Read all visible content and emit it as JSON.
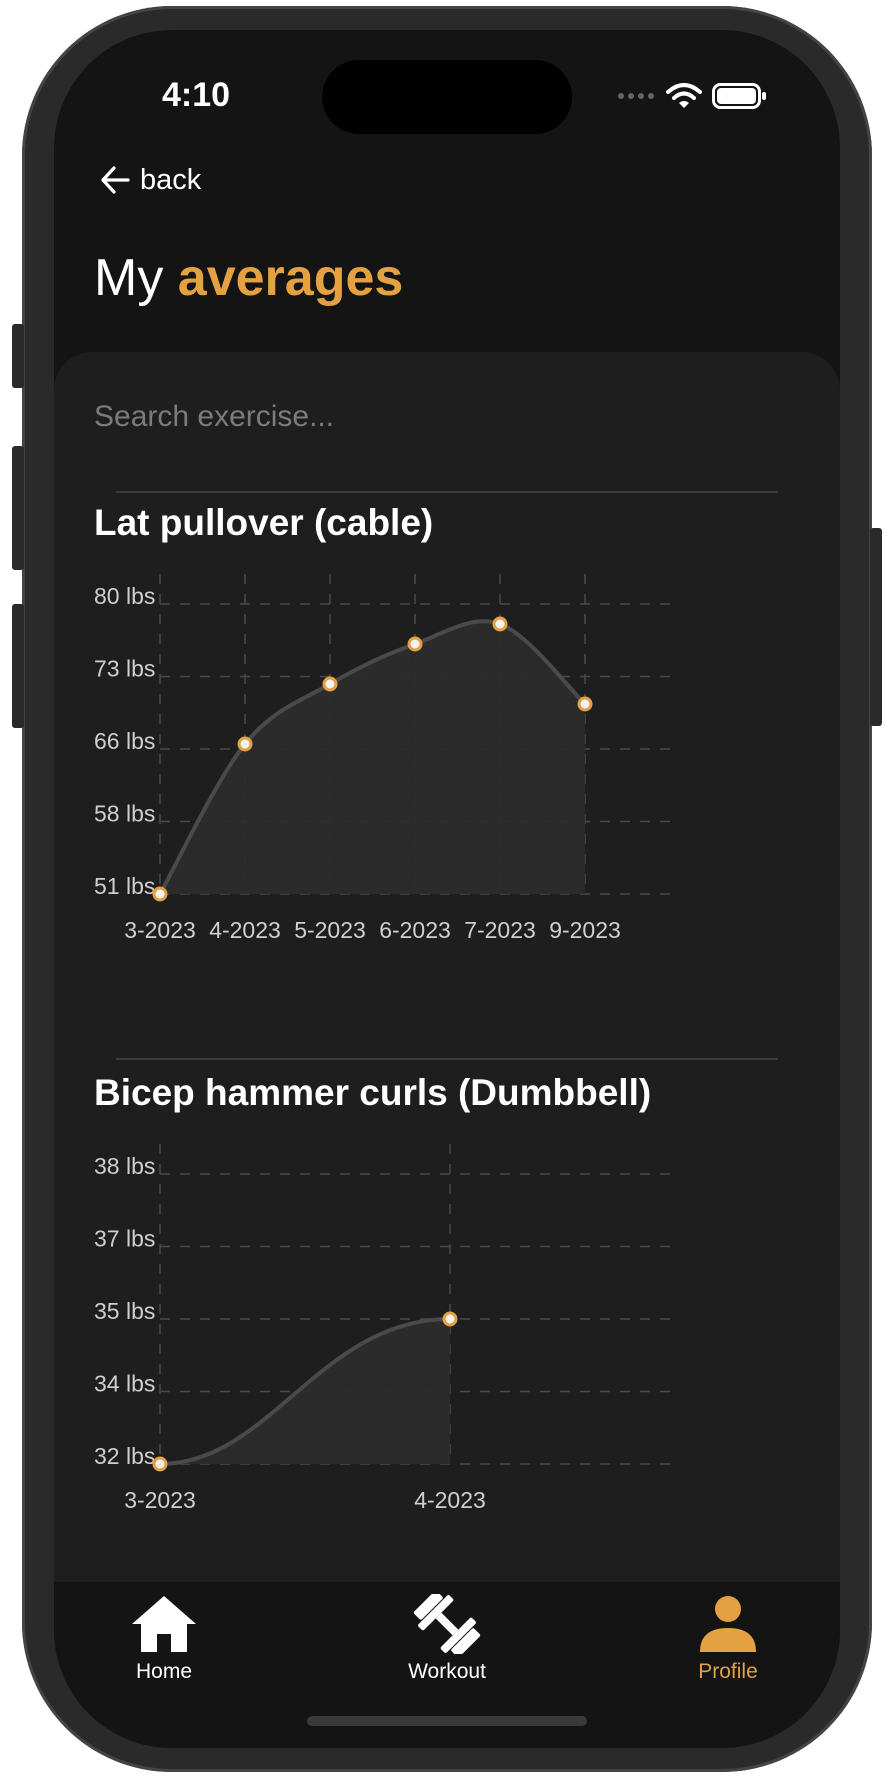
{
  "status": {
    "time": "4:10"
  },
  "nav": {
    "back_label": "back"
  },
  "page": {
    "title_plain": "My",
    "title_accent": "averages"
  },
  "search": {
    "placeholder": "Search exercise..."
  },
  "colors": {
    "accent": "#E3A141",
    "background": "#141414",
    "card": "#1e1e1e",
    "line": "#4a4a4a",
    "area": "#2c2c2c"
  },
  "charts": [
    {
      "title": "Lat pullover (cable)",
      "chart_data": {
        "type": "area",
        "title": "Lat pullover (cable)",
        "categories": [
          "3-2023",
          "4-2023",
          "5-2023",
          "6-2023",
          "7-2023",
          "9-2023"
        ],
        "values": [
          51,
          66,
          72,
          76,
          78,
          70
        ],
        "y_ticks": [
          "80 lbs",
          "73 lbs",
          "66 lbs",
          "58 lbs",
          "51 lbs"
        ],
        "ylim": [
          51,
          80
        ],
        "grid": true
      }
    },
    {
      "title": "Bicep hammer curls (Dumbbell)",
      "chart_data": {
        "type": "area",
        "title": "Bicep hammer curls (Dumbbell)",
        "categories": [
          "3-2023",
          "4-2023"
        ],
        "values": [
          32,
          35
        ],
        "y_ticks": [
          "38 lbs",
          "37 lbs",
          "35 lbs",
          "34 lbs",
          "32 lbs"
        ],
        "ylim": [
          32,
          38
        ],
        "grid": true
      }
    }
  ],
  "tabbar": {
    "items": [
      {
        "label": "Home",
        "icon": "home-icon",
        "active": false
      },
      {
        "label": "Workout",
        "icon": "dumbbell-icon",
        "active": false
      },
      {
        "label": "Profile",
        "icon": "person-icon",
        "active": true
      }
    ]
  }
}
